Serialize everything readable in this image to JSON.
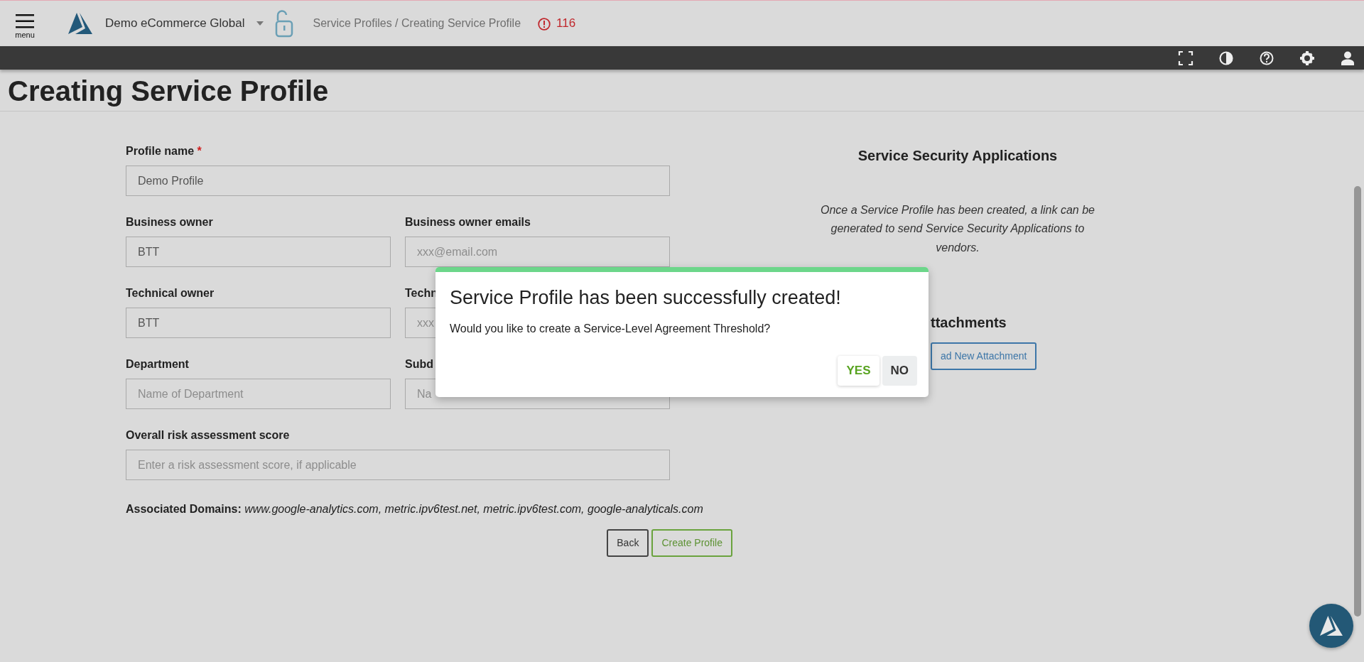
{
  "header": {
    "menu_label": "menu",
    "organization": "Demo eCommerce Global",
    "breadcrumb": "Service Profiles / Creating Service Profile",
    "alert_count": "116"
  },
  "page_title": "Creating Service Profile",
  "form": {
    "rows": [
      [
        {
          "label": "Profile name",
          "required_mark": "*",
          "value": "Demo Profile"
        }
      ],
      [
        {
          "label": "Business owner",
          "value": "BTT"
        },
        {
          "label": "Business owner emails",
          "placeholder": "xxx@email.com"
        }
      ],
      [
        {
          "label": "Technical owner",
          "value": "BTT"
        },
        {
          "label": "Techn",
          "placeholder": "xxx"
        }
      ],
      [
        {
          "label": "Department",
          "placeholder": "Name of Department"
        },
        {
          "label": "Subd",
          "placeholder": "Na"
        }
      ],
      [
        {
          "label": "Overall risk assessment score",
          "placeholder": "Enter a risk assessment score, if applicable"
        }
      ]
    ],
    "associated_domains": {
      "label": "Associated Domains:",
      "value": "www.google-analytics.com, metric.ipv6test.net, metric.ipv6test.com, google-analyticals.com"
    },
    "buttons": [
      {
        "label": "Back",
        "kind": "secondary"
      },
      {
        "label": "Create Profile",
        "kind": "success"
      }
    ]
  },
  "right_panel": {
    "title": "Service Security Applications",
    "note": "Once a Service Profile has been created, a link can be generated to send Service Security Applications to vendors.",
    "attachments_title": "ttachments",
    "attachment_button": "ad New Attachment"
  },
  "modal": {
    "title": "Service Profile has been successfully created!",
    "message": "Would you like to create a Service-Level Agreement Threshold?",
    "buttons": [
      {
        "label": "YES",
        "kind": "confirm"
      },
      {
        "label": "NO",
        "kind": "cancel"
      }
    ]
  }
}
